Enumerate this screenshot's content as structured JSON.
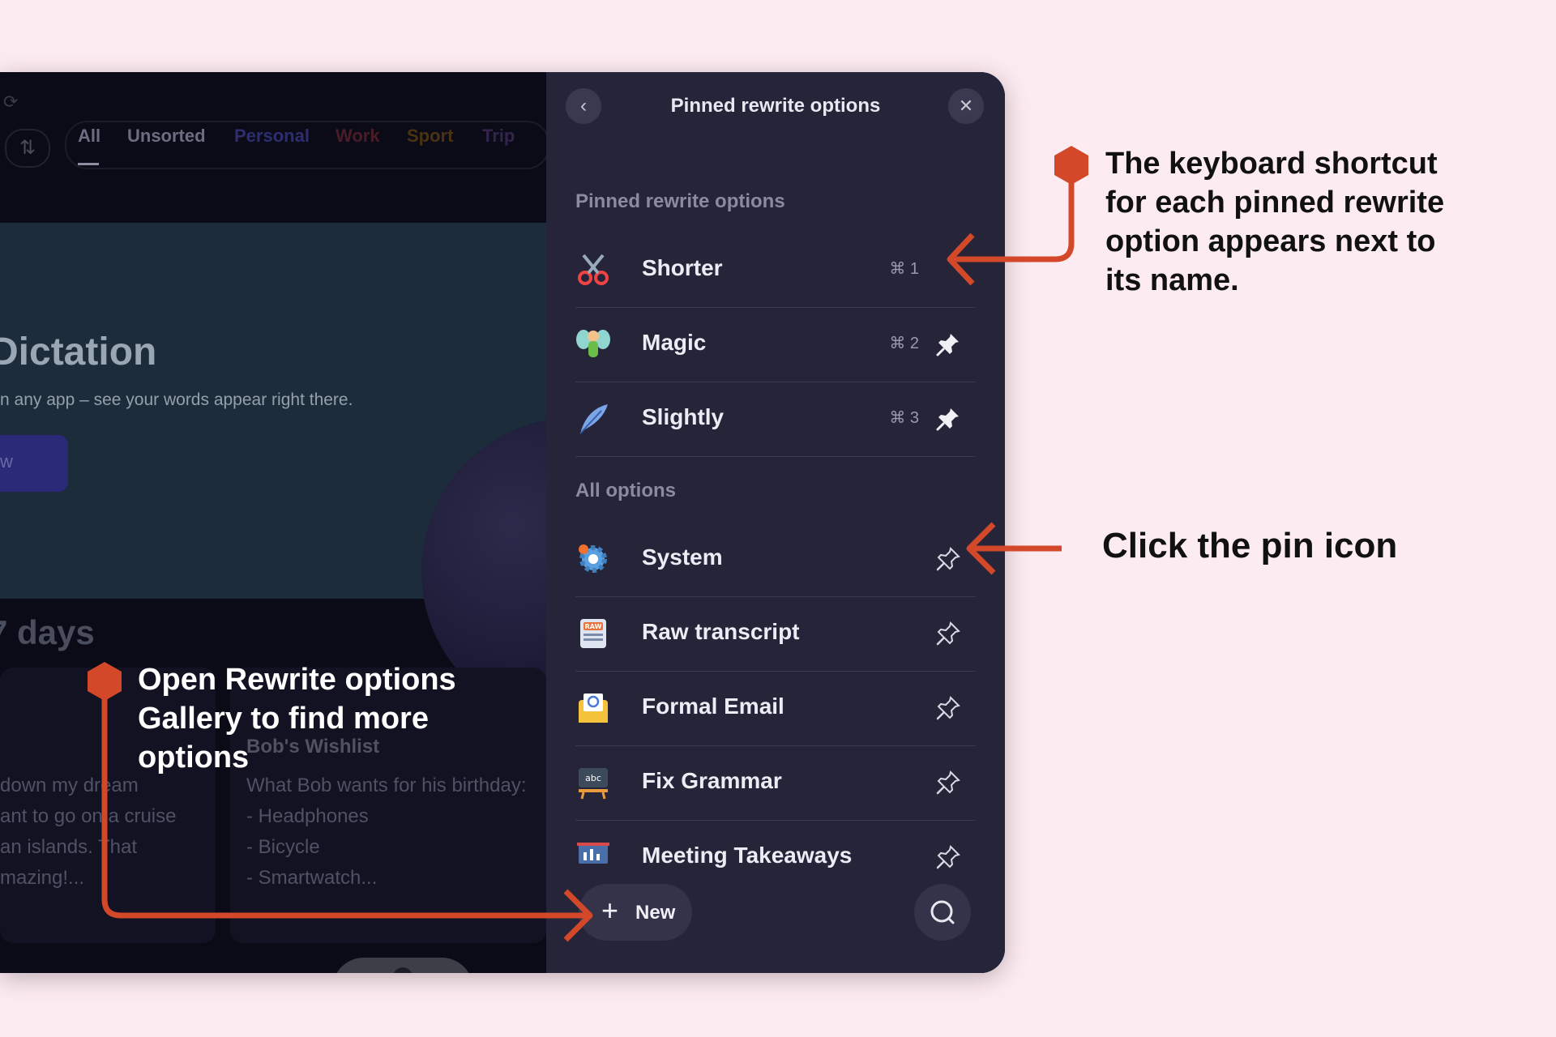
{
  "background_tabs": [
    "All",
    "Unsorted",
    "Personal",
    "Work",
    "Sport",
    "Trip"
  ],
  "tab_colors": [
    "#c8c8d0",
    "#8a8ca0",
    "#3b3a8a",
    "#5a1f2a",
    "#5a3a12",
    "#3a2a5a"
  ],
  "hero": {
    "title": "Dictation",
    "subtitle": "n any app – see your words appear right there.",
    "button_label": "w"
  },
  "recent_section": "7 days",
  "notes": {
    "left_lines": [
      "down my dream",
      "ant to go on a cruise",
      "an islands. That",
      "mazing!..."
    ],
    "right_title": "Bob's Wishlist",
    "right_lines": [
      "What Bob wants for his birthday:",
      "- Headphones",
      "- Bicycle",
      "- Smartwatch..."
    ]
  },
  "panel": {
    "title": "Pinned rewrite options",
    "back_icon": "chevron-left-icon",
    "close_icon": "close-icon",
    "pinned_section": "Pinned rewrite options",
    "all_section": "All options",
    "pinned": [
      {
        "label": "Shorter",
        "shortcut": "⌘ 1",
        "icon": "scissors-icon",
        "pinned": true,
        "show_pin": false
      },
      {
        "label": "Magic",
        "shortcut": "⌘ 2",
        "icon": "fairy-icon",
        "pinned": true,
        "show_pin": true
      },
      {
        "label": "Slightly",
        "shortcut": "⌘ 3",
        "icon": "feather-icon",
        "pinned": true,
        "show_pin": true
      }
    ],
    "options": [
      {
        "label": "System",
        "icon": "gear-icon"
      },
      {
        "label": "Raw transcript",
        "icon": "raw-icon"
      },
      {
        "label": "Formal Email",
        "icon": "envelope-icon"
      },
      {
        "label": "Fix Grammar",
        "icon": "abc-icon"
      },
      {
        "label": "Meeting Takeaways",
        "icon": "presentation-icon"
      }
    ],
    "new_label": "New",
    "new_icon": "plus-icon",
    "search_icon": "search-icon"
  },
  "annotations": {
    "shortcut_note": [
      "The keyboard shortcut",
      "for each pinned rewrite",
      "option appears next to",
      "its name."
    ],
    "pin_note": "Click the pin icon",
    "gallery_note": [
      "Open Rewrite options",
      "Gallery to find more",
      "options"
    ]
  },
  "colors": {
    "accent": "#d4482a",
    "panel": "#252439",
    "page": "#fdebf2"
  }
}
